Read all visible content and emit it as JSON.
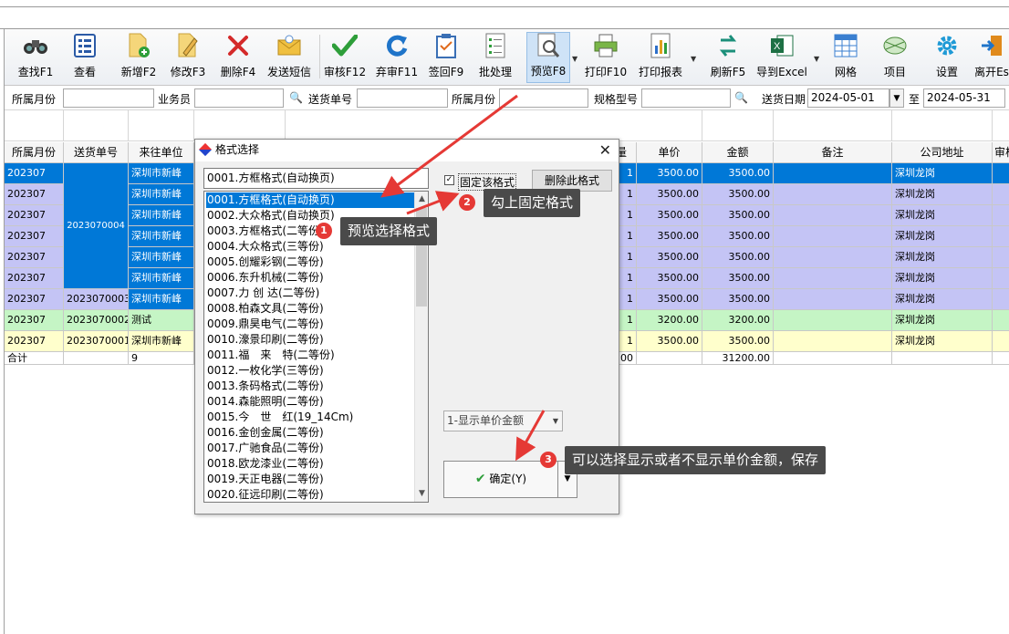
{
  "toolbar": {
    "buttons": [
      {
        "label": "查找F1",
        "icon": "binoculars-icon"
      },
      {
        "label": "查看",
        "icon": "view-list-icon"
      },
      {
        "label": "新增F2",
        "icon": "new-document-icon"
      },
      {
        "label": "修改F3",
        "icon": "edit-pencil-icon"
      },
      {
        "label": "删除F4",
        "icon": "delete-x-icon"
      },
      {
        "label": "发送短信",
        "icon": "sms-envelope-icon"
      },
      {
        "label": "审核F12",
        "icon": "check-icon"
      },
      {
        "label": "弃审F11",
        "icon": "refresh-arrow-icon"
      },
      {
        "label": "签回F9",
        "icon": "clipboard-icon"
      },
      {
        "label": "批处理",
        "icon": "batch-list-icon"
      },
      {
        "label": "预览F8",
        "icon": "preview-magnifier-icon"
      },
      {
        "label": "打印F10",
        "icon": "printer-icon"
      },
      {
        "label": "打印报表",
        "icon": "report-chart-icon"
      },
      {
        "label": "刷新F5",
        "icon": "refresh-dollar-icon"
      },
      {
        "label": "导到Excel",
        "icon": "excel-icon"
      },
      {
        "label": "网格",
        "icon": "grid-icon"
      },
      {
        "label": "项目",
        "icon": "project-icon"
      },
      {
        "label": "设置",
        "icon": "gear-icon"
      },
      {
        "label": "离开Es",
        "icon": "exit-door-icon"
      }
    ]
  },
  "filter": {
    "month_label": "所属月份",
    "salesman_label": "业务员",
    "delivery_no_label": "送货单号",
    "month_label2": "所属月份",
    "spec_label": "规格型号",
    "date_label": "送货日期",
    "date_from": "2024-05-01",
    "to_label": "至",
    "date_to": "2024-05-31"
  },
  "grid": {
    "headers": {
      "month": "所属月份",
      "delivery_no": "送货单号",
      "customer": "来往单位",
      "qty_frag": "量",
      "unit_price": "单价",
      "amount": "金额",
      "remark": "备注",
      "address": "公司地址",
      "audit": "审核"
    },
    "rows": [
      {
        "month": "202307",
        "customer": "深圳市新峰",
        "qty": "1",
        "price": "3500.00",
        "amount": "3500.00",
        "address": "深圳龙岗"
      },
      {
        "month": "202307",
        "customer": "深圳市新峰",
        "qty": "1",
        "price": "3500.00",
        "amount": "3500.00",
        "address": "深圳龙岗"
      },
      {
        "month": "202307",
        "customer": "深圳市新峰",
        "qty": "1",
        "price": "3500.00",
        "amount": "3500.00",
        "address": "深圳龙岗"
      },
      {
        "month": "202307",
        "customer": "深圳市新峰",
        "qty": "1",
        "price": "3500.00",
        "amount": "3500.00",
        "address": "深圳龙岗"
      },
      {
        "month": "202307",
        "customer": "深圳市新峰",
        "qty": "1",
        "price": "3500.00",
        "amount": "3500.00",
        "address": "深圳龙岗"
      },
      {
        "month": "202307",
        "customer": "深圳市新峰",
        "qty": "1",
        "price": "3500.00",
        "amount": "3500.00",
        "address": "深圳龙岗"
      },
      {
        "month": "202307",
        "delivery_no": "2023070003",
        "customer": "深圳市新峰",
        "qty": "1",
        "price": "3500.00",
        "amount": "3500.00",
        "address": "深圳龙岗"
      },
      {
        "month": "202307",
        "delivery_no": "2023070002",
        "customer": "测试",
        "qty": "1",
        "price": "3200.00",
        "amount": "3200.00",
        "address": "深圳龙岗"
      },
      {
        "month": "202307",
        "delivery_no": "2023070001",
        "customer": "深圳市新峰",
        "qty": "1",
        "price": "3500.00",
        "amount": "3500.00",
        "address": "深圳龙岗"
      }
    ],
    "merged_delivery_no": "2023070004",
    "total": {
      "label": "合计",
      "count": "9",
      "qty_frag": ".00",
      "amount": "31200.00"
    }
  },
  "dialog": {
    "title": "格式选择",
    "current": "0001.方框格式(自动换页)",
    "fixed_format_label": "固定该格式",
    "delete_format_label": "删除此格式",
    "display_option": "1-显示单价金额",
    "ok_label": "确定(Y)",
    "formats": [
      "0001.方框格式(自动换页)",
      "0002.大众格式(自动换页)",
      "0003.方框格式(二等份)",
      "0004.大众格式(三等份)",
      "0005.创耀彩钢(二等份)",
      "0006.东升机械(二等份)",
      "0007.力 创 达(二等份)",
      "0008.柏森文具(二等份)",
      "0009.鼎昊电气(二等份)",
      "0010.濠景印刷(二等份)",
      "0011.福　来　特(二等份)",
      "0012.一枚化学(三等份)",
      "0013.条码格式(二等份)",
      "0014.森能照明(二等份)",
      "0015.今　世　红(19_14Cm)",
      "0016.金创金属(二等份)",
      "0017.广驰食品(二等份)",
      "0018.欧龙漆业(二等份)",
      "0019.天正电器(二等份)",
      "0020.征远印刷(二等份)"
    ]
  },
  "annotations": [
    {
      "num": "1",
      "text": "预览选择格式"
    },
    {
      "num": "2",
      "text": "勾上固定格式"
    },
    {
      "num": "3",
      "text": "可以选择显示或者不显示单价金额，保存"
    }
  ],
  "colors": {
    "selected_row": "#0078d7",
    "purple_row": "#c4c4f5",
    "green_row": "#c5f5c5",
    "yellow_row": "#ffffcc",
    "annotation_red": "#e53935",
    "tooltip_bg": "#4a4a4a"
  }
}
